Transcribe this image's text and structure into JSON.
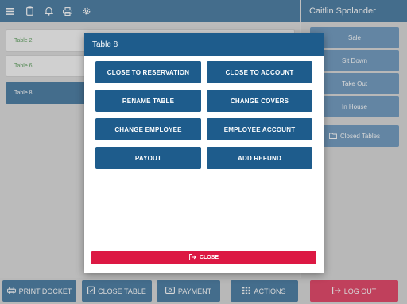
{
  "header": {
    "icons": [
      "menu-icon",
      "clipboard-icon",
      "bell-icon",
      "printer-icon",
      "gear-icon"
    ],
    "user_name": "Caitlin Spolander"
  },
  "tables": [
    {
      "label": "Table 2",
      "active": false
    },
    {
      "label": "Table 6",
      "active": false
    },
    {
      "label": "Table 8",
      "active": true
    }
  ],
  "sidebar": {
    "sale": "Sale",
    "sit_down": "Sit Down",
    "take_out": "Take Out",
    "in_house": "In House",
    "closed_tables": "Closed Tables"
  },
  "bottom": {
    "print_docket": "PRINT DOCKET",
    "close_table": "CLOSE TABLE",
    "payment": "PAYMENT",
    "actions": "ACTIONS",
    "log_out": "LOG OUT"
  },
  "modal": {
    "title": "Table 8",
    "actions": [
      "CLOSE TO RESERVATION",
      "CLOSE TO ACCOUNT",
      "RENAME TABLE",
      "CHANGE COVERS",
      "CHANGE EMPLOYEE",
      "EMPLOYEE ACCOUNT",
      "PAYOUT",
      "ADD REFUND"
    ],
    "close_label": "CLOSE"
  },
  "colors": {
    "primary": "#1e5c8c",
    "secondary": "#4d82b0",
    "danger": "#dc1843",
    "table_text": "#3a8a3a"
  }
}
